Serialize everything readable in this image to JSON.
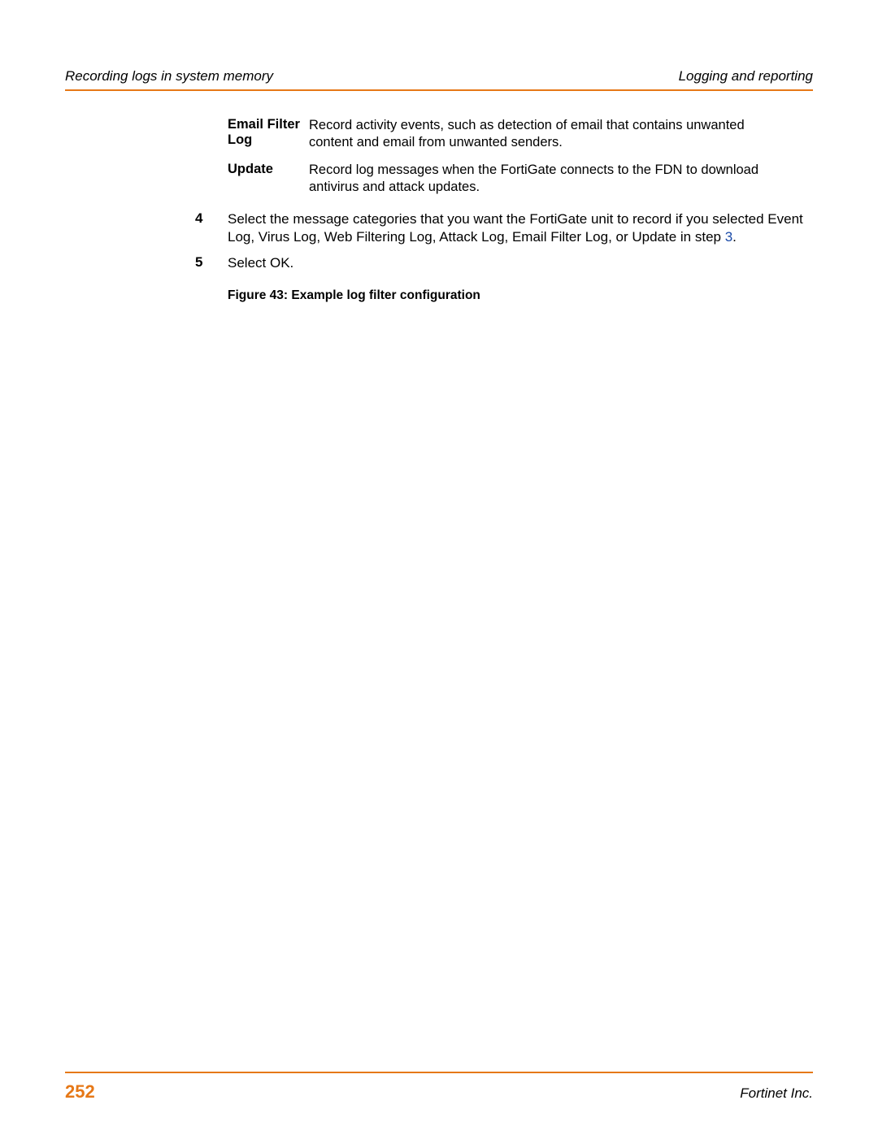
{
  "header": {
    "left": "Recording logs in system memory",
    "right": "Logging and reporting"
  },
  "defs": [
    {
      "term": "Email Filter Log",
      "desc": "Record activity events, such as detection of email that contains unwanted content and email from unwanted senders."
    },
    {
      "term": "Update",
      "desc": "Record log messages when the FortiGate connects to the FDN to download antivirus and attack updates."
    }
  ],
  "steps": [
    {
      "num": "4",
      "body_pre": "Select the message categories that you want the FortiGate unit to record if you selected Event Log, Virus Log, Web Filtering Log, Attack Log, Email Filter Log, or Update in step ",
      "link": "3",
      "body_post": "."
    },
    {
      "num": "5",
      "body_pre": "Select OK.",
      "link": "",
      "body_post": ""
    }
  ],
  "figure_caption": "Figure 43: Example log filter configuration",
  "footer": {
    "page": "252",
    "right": "Fortinet Inc."
  }
}
